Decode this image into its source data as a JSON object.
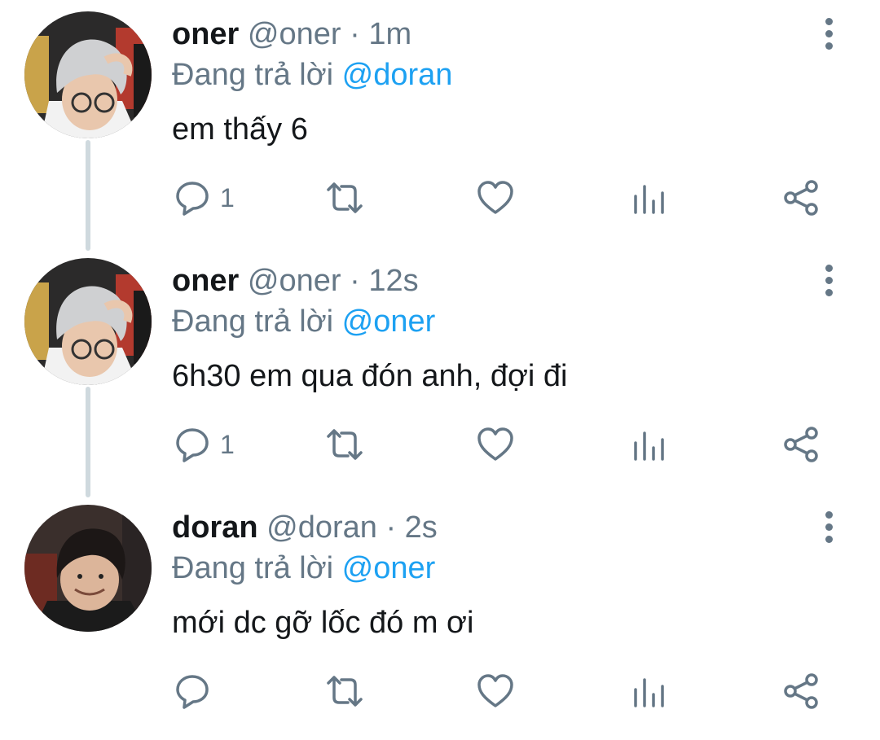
{
  "colors": {
    "primary_text": "#14171a",
    "secondary_text": "#657786",
    "link": "#1da1f2",
    "thread_line": "#cfd9de"
  },
  "tweets": [
    {
      "display_name": "oner",
      "handle": "@oner",
      "separator": "·",
      "time": "1m",
      "reply_prefix": "Đang trả lời",
      "reply_to": "@doran",
      "text": "em thấy 6",
      "reply_count": "1",
      "avatar_icon": "user-avatar-light-hair"
    },
    {
      "display_name": "oner",
      "handle": "@oner",
      "separator": "·",
      "time": "12s",
      "reply_prefix": "Đang trả lời",
      "reply_to": "@oner",
      "text": "6h30 em qua đón anh, đợi đi",
      "reply_count": "1",
      "avatar_icon": "user-avatar-light-hair"
    },
    {
      "display_name": "doran",
      "handle": "@doran",
      "separator": "·",
      "time": "2s",
      "reply_prefix": "Đang trả lời",
      "reply_to": "@oner",
      "text": "mới dc gỡ lốc đó m ơi",
      "reply_count": "",
      "avatar_icon": "user-avatar-dark-hair"
    }
  ],
  "icons": {
    "reply": "reply-icon",
    "retweet": "retweet-icon",
    "like": "heart-icon",
    "analytics": "analytics-icon",
    "share": "share-icon",
    "more": "more-options-icon"
  }
}
